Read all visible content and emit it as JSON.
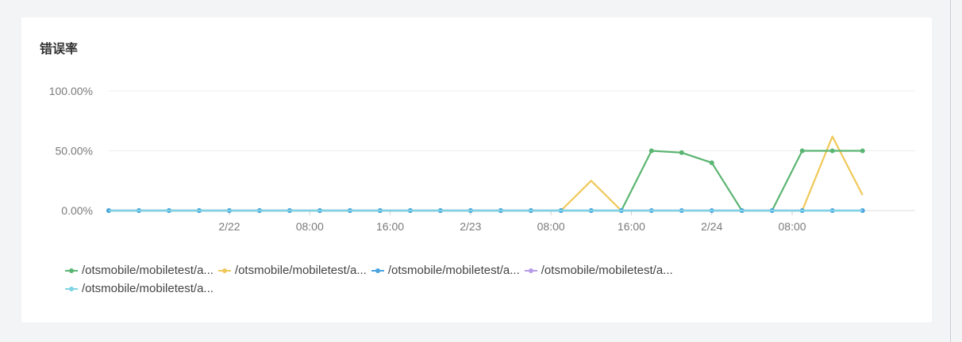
{
  "card": {
    "title": "错误率"
  },
  "chart_data": {
    "type": "line",
    "title": "错误率",
    "xlabel": "",
    "ylabel": "",
    "ylim": [
      0,
      100
    ],
    "ytick_labels": [
      "0.00%",
      "50.00%",
      "100.00%"
    ],
    "x_range": [
      "2/21 12:00",
      "2/24 20:00"
    ],
    "x": [
      "2/21 12:00",
      "2/21 15:00",
      "2/21 18:00",
      "2/21 21:00",
      "2/22 00:00",
      "2/22 03:00",
      "2/22 06:00",
      "2/22 09:00",
      "2/22 12:00",
      "2/22 15:00",
      "2/22 18:00",
      "2/22 21:00",
      "2/23 00:00",
      "2/23 03:00",
      "2/23 06:00",
      "2/23 09:00",
      "2/23 12:00",
      "2/23 15:00",
      "2/23 18:00",
      "2/23 21:00",
      "2/24 00:00",
      "2/24 03:00",
      "2/24 06:00",
      "2/24 09:00",
      "2/24 12:00",
      "2/24 15:00"
    ],
    "xtick_labels": [
      {
        "label": "2/22",
        "at": "2/22 00:00"
      },
      {
        "label": "08:00",
        "at": "2/22 08:00"
      },
      {
        "label": "16:00",
        "at": "2/22 16:00"
      },
      {
        "label": "2/23",
        "at": "2/23 00:00"
      },
      {
        "label": "08:00",
        "at": "2/23 08:00"
      },
      {
        "label": "16:00",
        "at": "2/23 16:00"
      },
      {
        "label": "2/24",
        "at": "2/24 00:00"
      },
      {
        "label": "08:00",
        "at": "2/24 08:00"
      }
    ],
    "grid": true,
    "legend_position": "bottom",
    "series": [
      {
        "name": "/otsmobile/mobiletest/a...",
        "color": "#5bb572",
        "values": [
          0,
          0,
          0,
          0,
          0,
          0,
          0,
          0,
          0,
          0,
          0,
          0,
          0,
          0,
          0,
          0,
          0,
          0,
          50,
          48.5,
          40,
          0,
          0,
          50,
          50,
          50
        ]
      },
      {
        "name": "/otsmobile/mobiletest/a...",
        "color": "#f0c85a",
        "values": [
          0,
          0,
          0,
          0,
          0,
          0,
          0,
          0,
          0,
          0,
          0,
          0,
          0,
          0,
          0,
          0,
          25,
          0,
          0,
          0,
          0,
          0,
          0,
          0,
          62,
          13
        ]
      },
      {
        "name": "/otsmobile/mobiletest/a...",
        "color": "#4aa3df",
        "values": [
          0,
          0,
          0,
          0,
          0,
          0,
          0,
          0,
          0,
          0,
          0,
          0,
          0,
          0,
          0,
          0,
          0,
          0,
          0,
          0,
          0,
          0,
          0,
          0,
          0,
          0
        ]
      },
      {
        "name": "/otsmobile/mobiletest/a...",
        "color": "#b79be8",
        "values": [
          0,
          0,
          0,
          0,
          0,
          0,
          0,
          0,
          0,
          0,
          0,
          0,
          0,
          0,
          0,
          0,
          0,
          0,
          0,
          0,
          0,
          0,
          0,
          0,
          0,
          0
        ]
      },
      {
        "name": "/otsmobile/mobiletest/a...",
        "color": "#7fd3e6",
        "values": [
          0,
          0,
          0,
          0,
          0,
          0,
          0,
          0,
          0,
          0,
          0,
          0,
          0,
          0,
          0,
          0,
          0,
          0,
          0,
          0,
          0,
          0,
          0,
          0,
          0,
          0
        ]
      }
    ]
  }
}
